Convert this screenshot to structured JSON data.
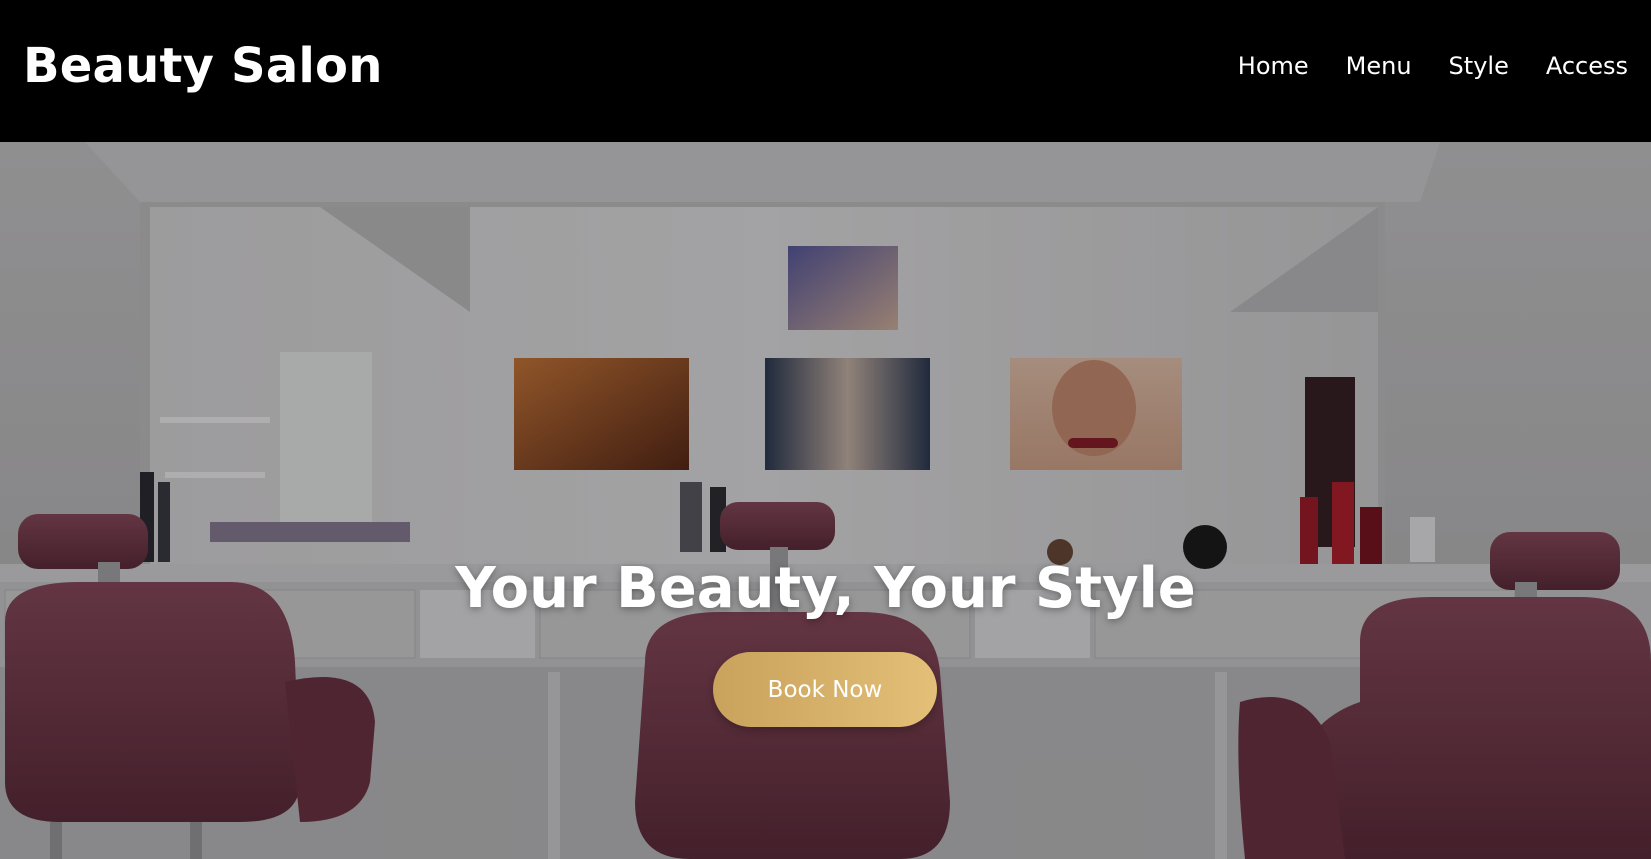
{
  "header": {
    "brand": "Beauty Salon",
    "nav": [
      {
        "label": "Home"
      },
      {
        "label": "Menu"
      },
      {
        "label": "Style"
      },
      {
        "label": "Access"
      }
    ]
  },
  "hero": {
    "title": "Your Beauty, Your Style",
    "cta_label": "Book Now",
    "image": "salon interior with mirror, wall portraits and burgundy salon chairs"
  },
  "colors": {
    "header_bg": "#000000",
    "text": "#ffffff",
    "button_gradient_start": "#c9a25c",
    "button_gradient_end": "#e3bf77",
    "chair": "#7a3f50"
  }
}
